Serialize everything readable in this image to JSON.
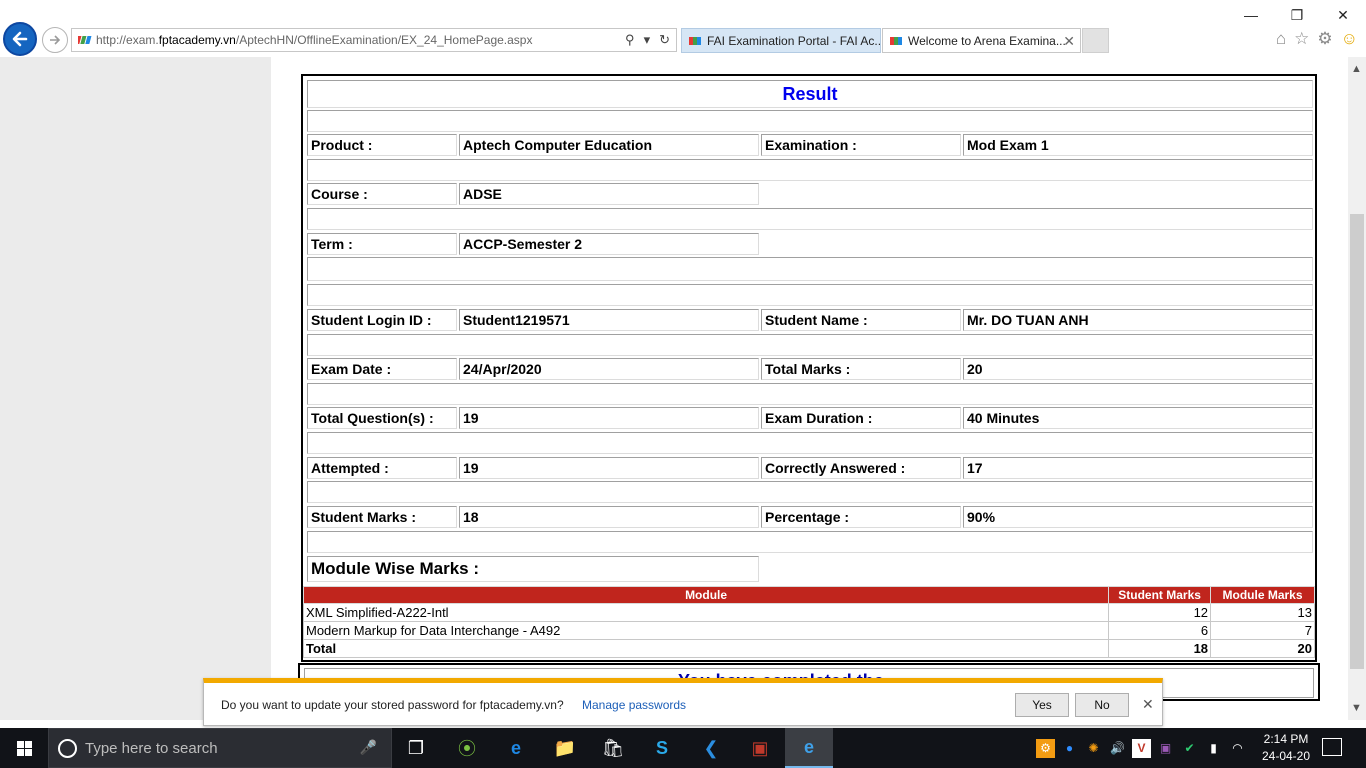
{
  "browser": {
    "url_prefix": "http://exam.",
    "url_domain": "fptacademy.vn",
    "url_path": "/AptechHN/OfflineExamination/EX_24_HomePage.aspx",
    "tabs": [
      {
        "title": "FAI Examination Portal - FAI Ac...",
        "active": true
      },
      {
        "title": "Welcome to Arena Examina...",
        "active": false
      }
    ]
  },
  "result": {
    "title": "Result",
    "rows": [
      {
        "l1": "Product :",
        "v1": "Aptech Computer Education",
        "l2": "Examination :",
        "v2": "Mod Exam 1"
      },
      {
        "l1": "Course :",
        "v1": "ADSE"
      },
      {
        "l1": "Term :",
        "v1": "ACCP-Semester 2"
      },
      {
        "l1": "Student Login ID :",
        "v1": "Student1219571",
        "l2": "Student Name :",
        "v2": "Mr. DO TUAN ANH"
      },
      {
        "l1": "Exam Date :",
        "v1": "24/Apr/2020",
        "l2": "Total Marks :",
        "v2": "20"
      },
      {
        "l1": "Total Question(s) :",
        "v1": "19",
        "l2": "Exam Duration :",
        "v2": "40 Minutes"
      },
      {
        "l1": "Attempted :",
        "v1": "19",
        "l2": "Correctly Answered :",
        "v2": "17"
      },
      {
        "l1": "Student Marks :",
        "v1": "18",
        "l2": "Percentage :",
        "v2": "90%"
      }
    ],
    "module_wise_label": "Module Wise Marks :"
  },
  "module_table": {
    "headers": [
      "Module",
      "Student Marks",
      "Module Marks"
    ],
    "rows": [
      [
        "XML Simplified-A222-Intl",
        "12",
        "13"
      ],
      [
        "Modern Markup for Data Interchange - A492",
        "6",
        "7"
      ]
    ],
    "total": [
      "Total",
      "18",
      "20"
    ]
  },
  "second_panel": {
    "partial_message": "You have completed the"
  },
  "notification": {
    "question": "Do you want to update your stored password for fptacademy.vn?",
    "manage_link": "Manage passwords",
    "yes": "Yes",
    "no": "No"
  },
  "taskbar": {
    "search_placeholder": "Type here to search",
    "time": "2:14 PM",
    "date": "24-04-20"
  },
  "colors": {
    "accent_red": "#c0251d",
    "title_blue": "#0000ee",
    "notification_orange": "#f2a900",
    "taskbar": "#111318"
  }
}
